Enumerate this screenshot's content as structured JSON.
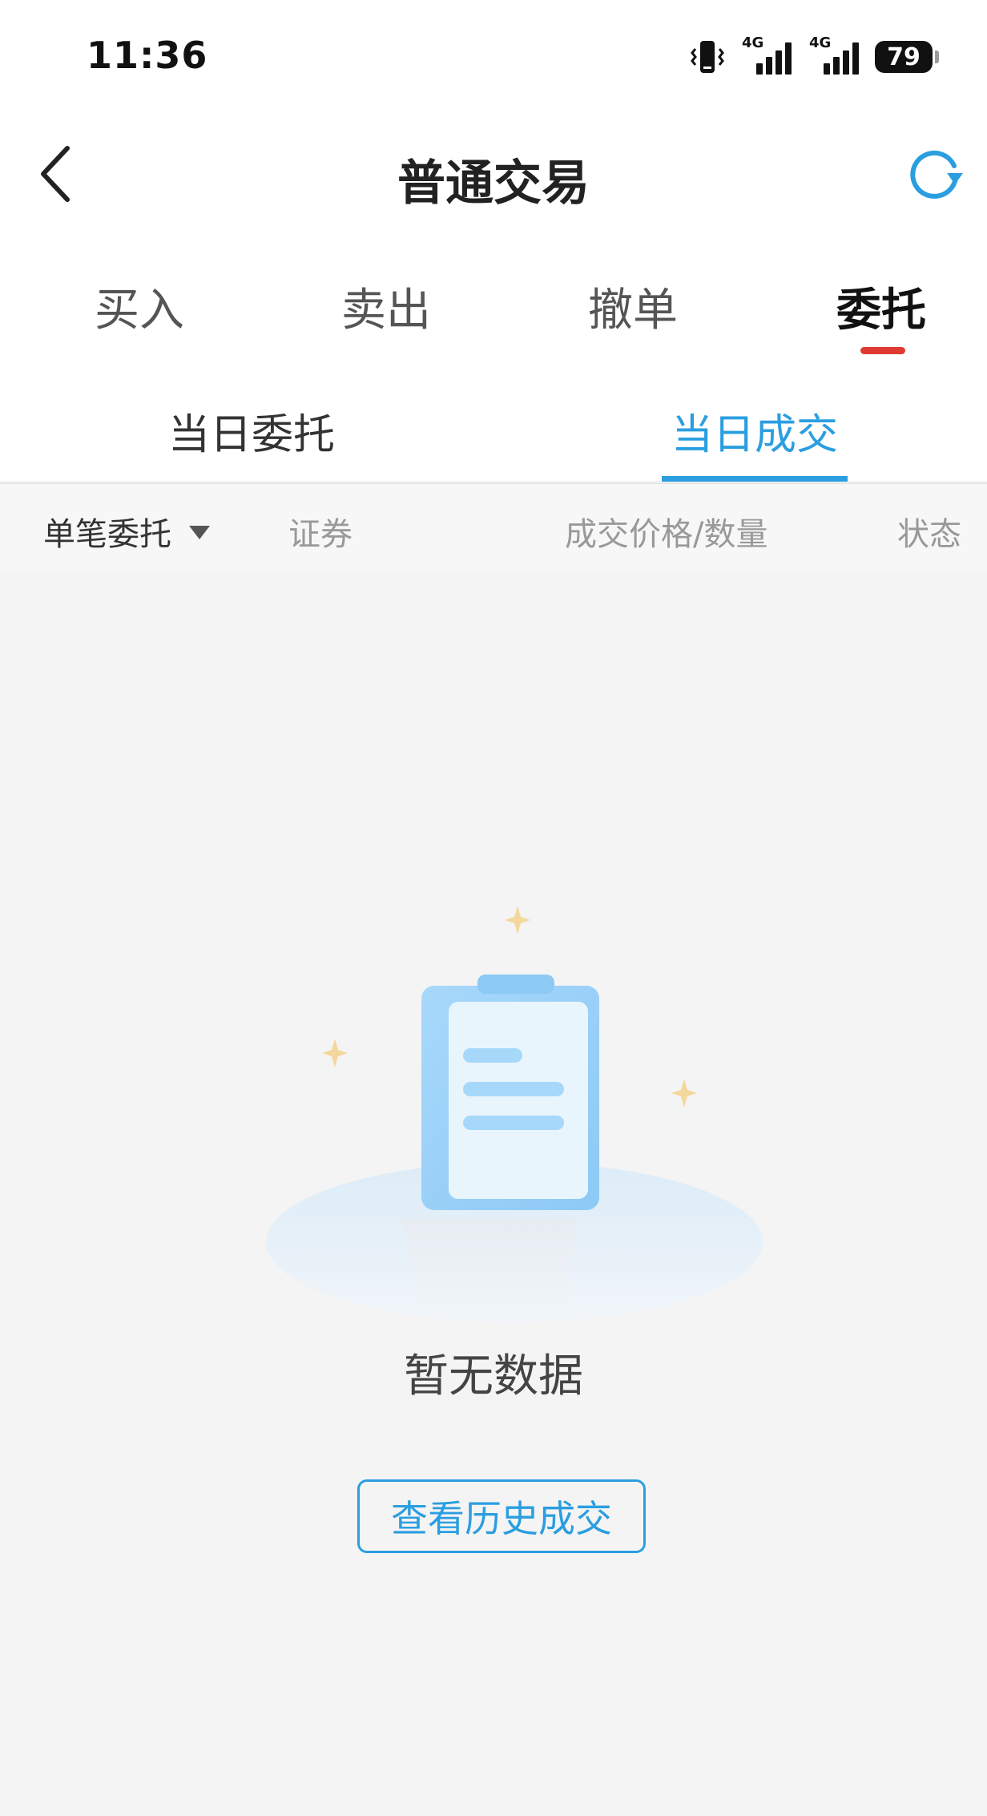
{
  "status_bar": {
    "time": "11:36",
    "network_1": "4G",
    "network_2": "4G",
    "battery": "79",
    "icons": [
      "vibrate-icon",
      "signal-icon",
      "signal-icon",
      "battery-icon"
    ]
  },
  "header": {
    "title": "普通交易",
    "back_icon": "chevron-left-icon",
    "refresh_icon": "refresh-icon",
    "accent_color": "#2b9ee0"
  },
  "main_tabs": [
    {
      "label": "买入",
      "active": false
    },
    {
      "label": "卖出",
      "active": false
    },
    {
      "label": "撤单",
      "active": false
    },
    {
      "label": "委托",
      "active": true
    }
  ],
  "main_tab_indicator_color": "#e03a32",
  "sub_tabs": [
    {
      "label": "当日委托",
      "active": false
    },
    {
      "label": "当日成交",
      "active": true
    }
  ],
  "table_header": {
    "filter_label": "单笔委托",
    "columns": [
      "证券",
      "成交价格/数量",
      "状态"
    ]
  },
  "empty_state": {
    "illustration": "clipboard-icon",
    "message": "暂无数据",
    "button_label": "查看历史成交"
  }
}
